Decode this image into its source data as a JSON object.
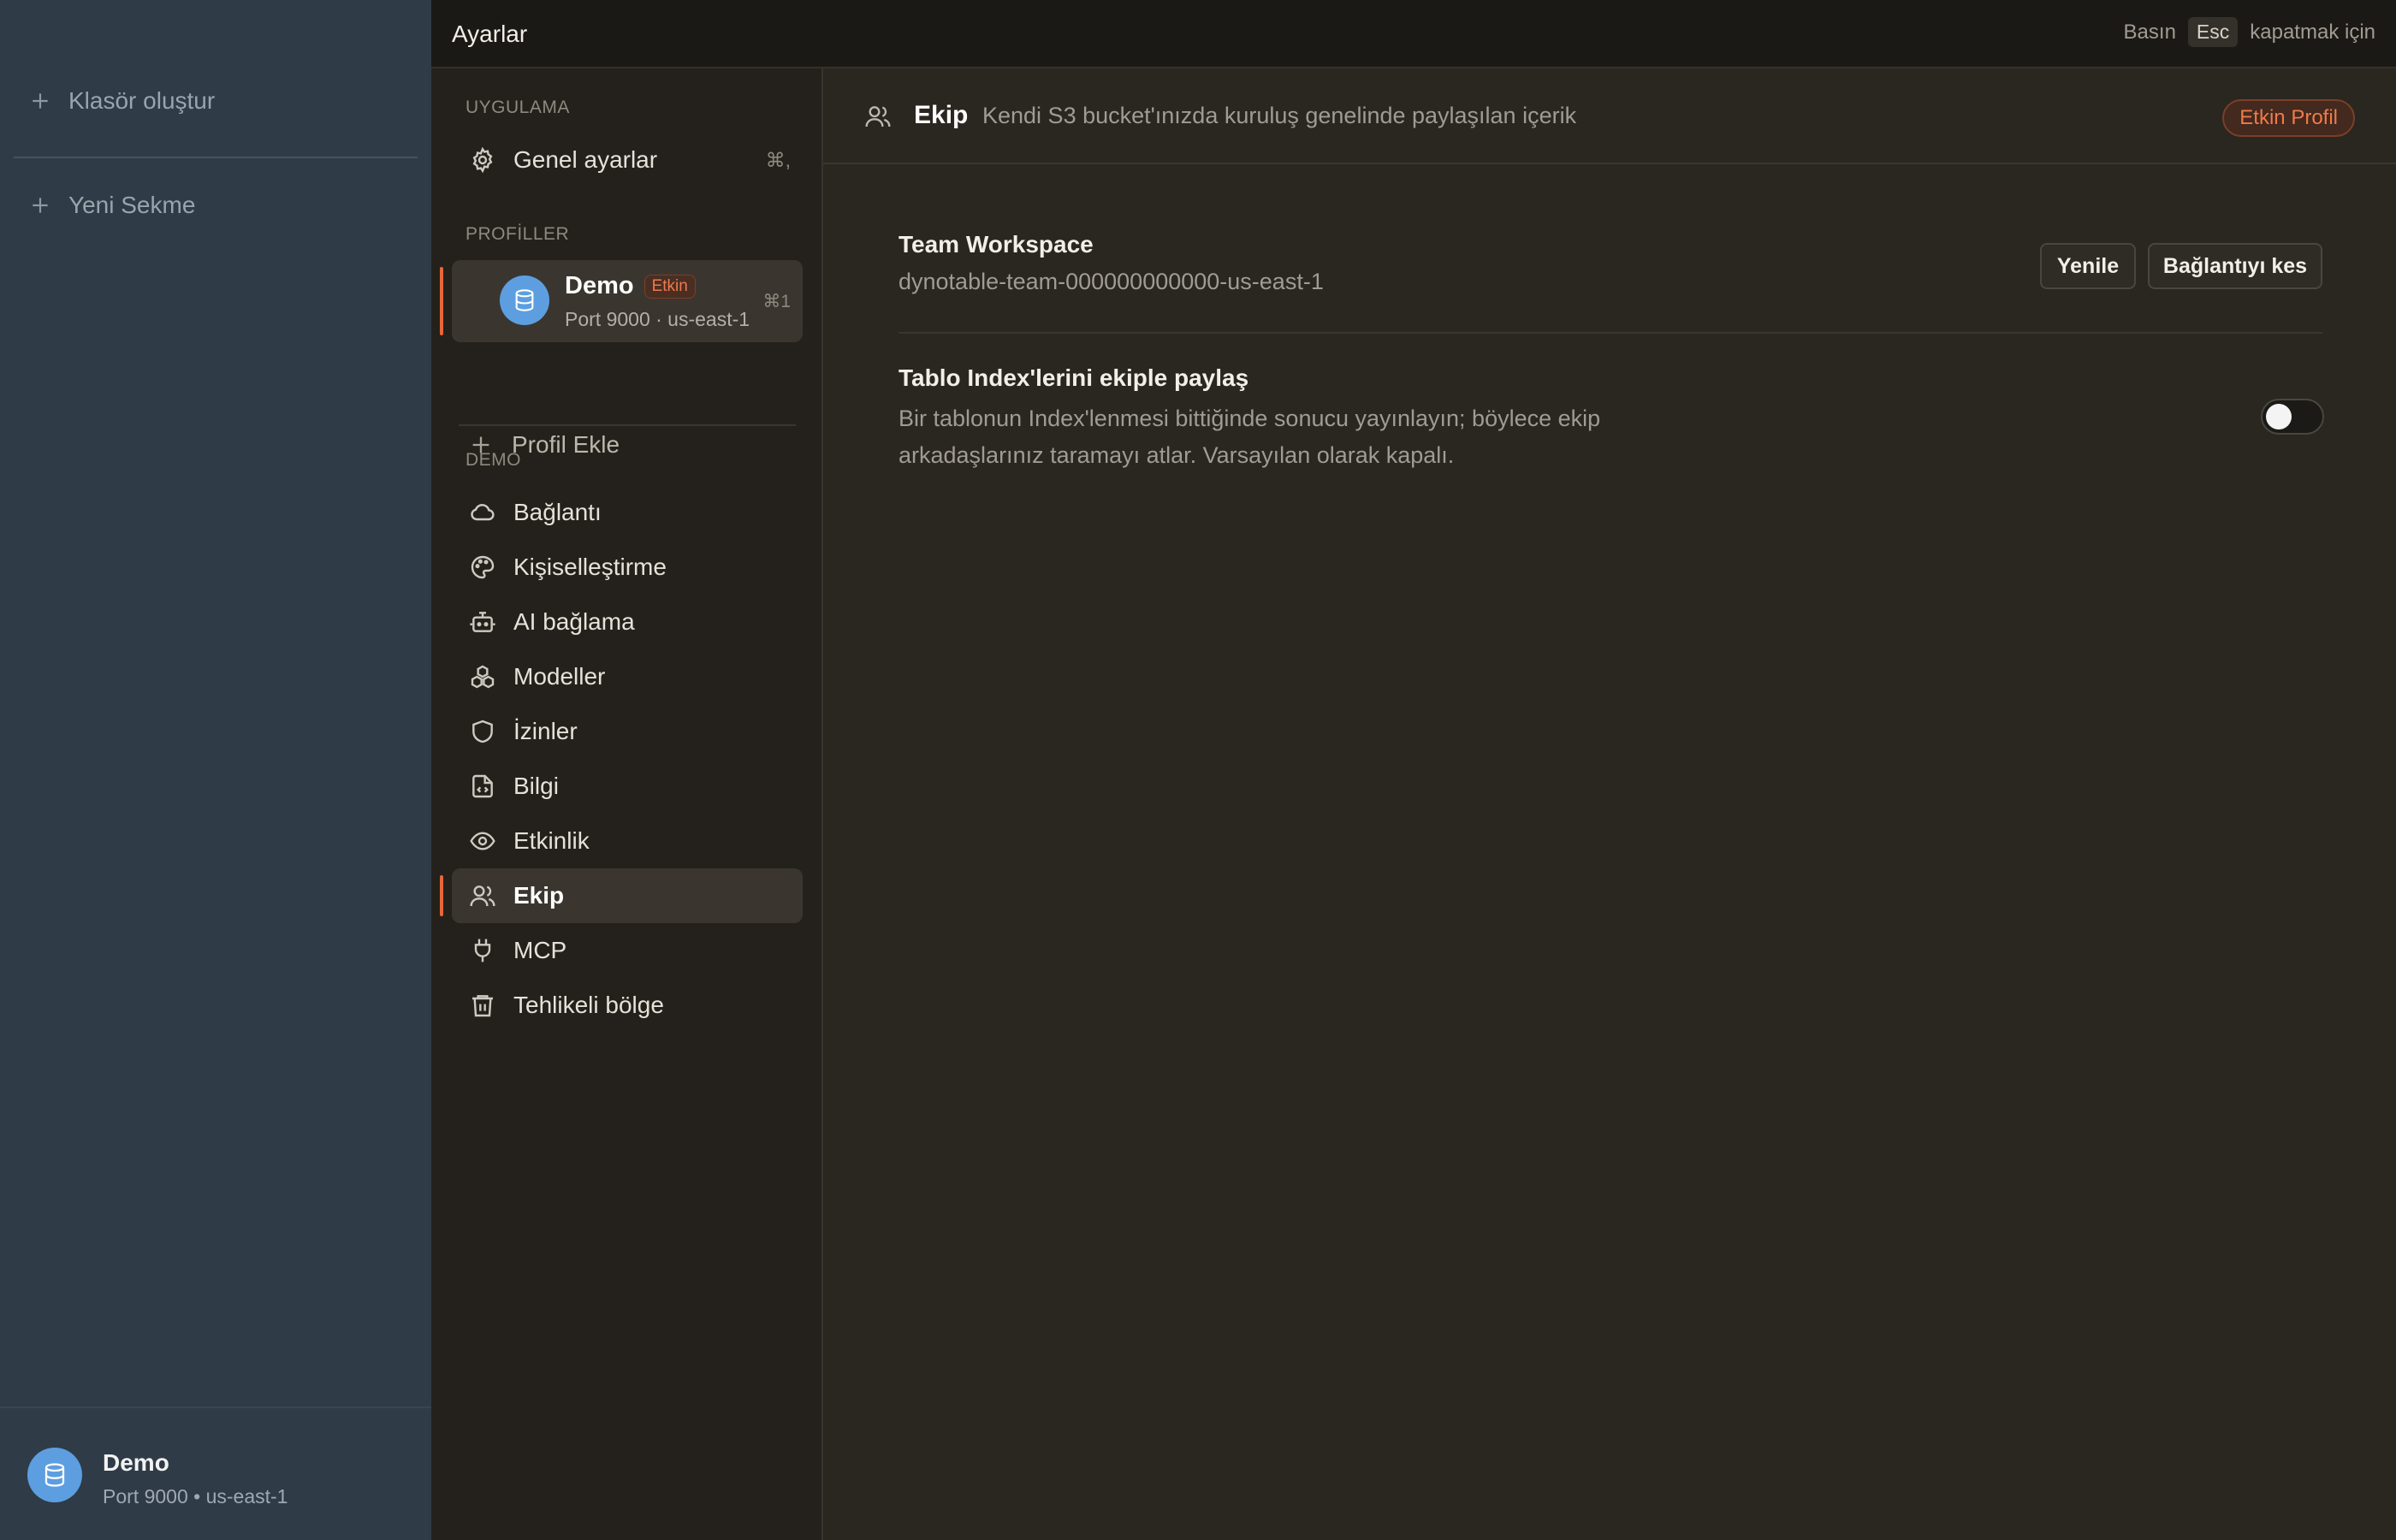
{
  "app_sidebar": {
    "create_folder": "Klasör oluştur",
    "new_tab": "Yeni Sekme",
    "footer": {
      "name": "Demo",
      "sub": "Port 9000 • us-east-1"
    }
  },
  "header": {
    "title": "Ayarlar",
    "hint_press": "Basın",
    "hint_key": "Esc",
    "hint_close": "kapatmak için"
  },
  "nav": {
    "section_app": "UYGULAMA",
    "general": {
      "label": "Genel ayarlar",
      "shortcut": "⌘,"
    },
    "section_profiles": "PROFİLLER",
    "profile": {
      "name": "Demo",
      "badge": "Etkin",
      "sub": "Port 9000 · us-east-1",
      "shortcut": "⌘1"
    },
    "add_profile": "Profil Ekle",
    "section_demo": "DEMO",
    "items": [
      {
        "label": "Bağlantı",
        "icon": "cloud-icon"
      },
      {
        "label": "Kişiselleştirme",
        "icon": "palette-icon"
      },
      {
        "label": "AI bağlama",
        "icon": "bot-icon"
      },
      {
        "label": "Modeller",
        "icon": "boxes-icon"
      },
      {
        "label": "İzinler",
        "icon": "shield-icon"
      },
      {
        "label": "Bilgi",
        "icon": "file-code-icon"
      },
      {
        "label": "Etkinlik",
        "icon": "eye-icon"
      },
      {
        "label": "Ekip",
        "icon": "users-icon"
      },
      {
        "label": "MCP",
        "icon": "plug-icon"
      },
      {
        "label": "Tehlikeli bölge",
        "icon": "trash-icon"
      }
    ],
    "active_item": "Ekip"
  },
  "content": {
    "title": "Ekip",
    "description": "Kendi S3 bucket'ınızda kuruluş genelinde paylaşılan içerik",
    "active_profile_badge": "Etkin Profil",
    "workspace": {
      "title": "Team Workspace",
      "id": "dynotable-team-000000000000-us-east-1",
      "refresh_label": "Yenile",
      "disconnect_label": "Bağlantıyı kes"
    },
    "share_index": {
      "title": "Tablo Index'lerini ekiple paylaş",
      "desc_line1": "Bir tablonun Index'lenmesi bittiğinde sonucu yayınlayın; böylece ekip",
      "desc_line2": "arkadaşlarınız taramayı atlar. Varsayılan olarak kapalı.",
      "enabled": false
    }
  },
  "colors": {
    "accent": "#e8663a",
    "avatar": "#5d9ee0",
    "app_sidebar_bg": "#2f3b47",
    "panel_bg": "#2a2620"
  }
}
